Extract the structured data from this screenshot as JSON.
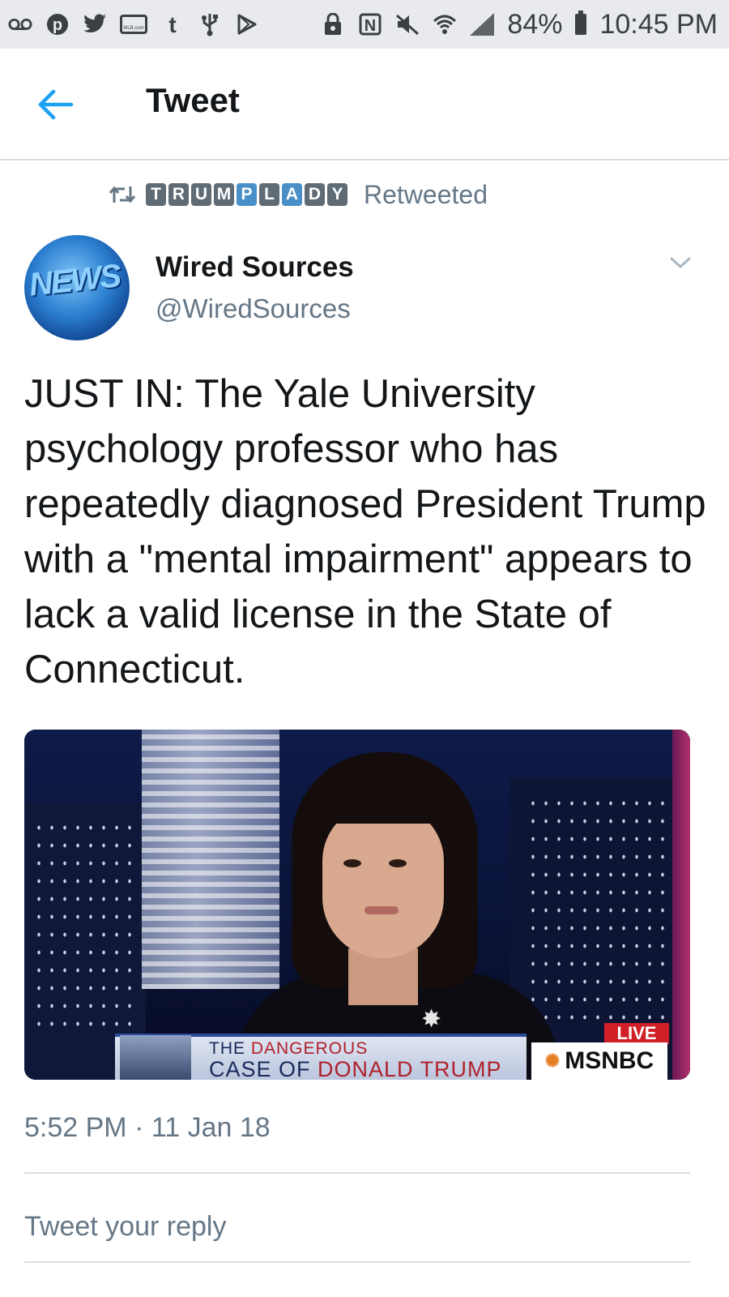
{
  "status_bar": {
    "icons": [
      "voicemail-icon",
      "pinterest-icon",
      "twitter-icon",
      "mlb-icon",
      "tumblr-icon",
      "usb-icon",
      "play-icon",
      "lock-icon",
      "nfc-icon",
      "mute-icon",
      "wifi-icon",
      "signal-icon",
      "battery-icon"
    ],
    "mlb_label": "MLB.com",
    "battery": "84%",
    "time": "10:45 PM"
  },
  "header": {
    "title": "Tweet"
  },
  "retweet": {
    "tiles": [
      "T",
      "R",
      "U",
      "M",
      "P",
      "L",
      "A",
      "D",
      "Y"
    ],
    "label": "Retweeted",
    "tile_color": "#5f6b75",
    "tile_accent": "#4a90c8"
  },
  "author": {
    "name": "Wired Sources",
    "handle": "@WiredSources",
    "avatar_text": "NEWS"
  },
  "tweet": {
    "text": "JUST IN: The Yale University psychology professor who has repeatedly diagnosed President Trump with a \"mental impairment\" appears to lack a valid license in the State of Connecticut.",
    "timestamp": "5:52 PM · 11 Jan 18"
  },
  "media": {
    "lower_third_line1_a": "THE ",
    "lower_third_line1_b": "DANGEROUS",
    "lower_third_line2_a": "CASE OF ",
    "lower_third_line2_b": "DONALD TRUMP",
    "live_label": "LIVE",
    "network": "MSNBC"
  },
  "reply": {
    "placeholder": "Tweet your reply"
  },
  "colors": {
    "accent": "#1da1f2",
    "text": "#14171a",
    "secondary": "#657786"
  }
}
